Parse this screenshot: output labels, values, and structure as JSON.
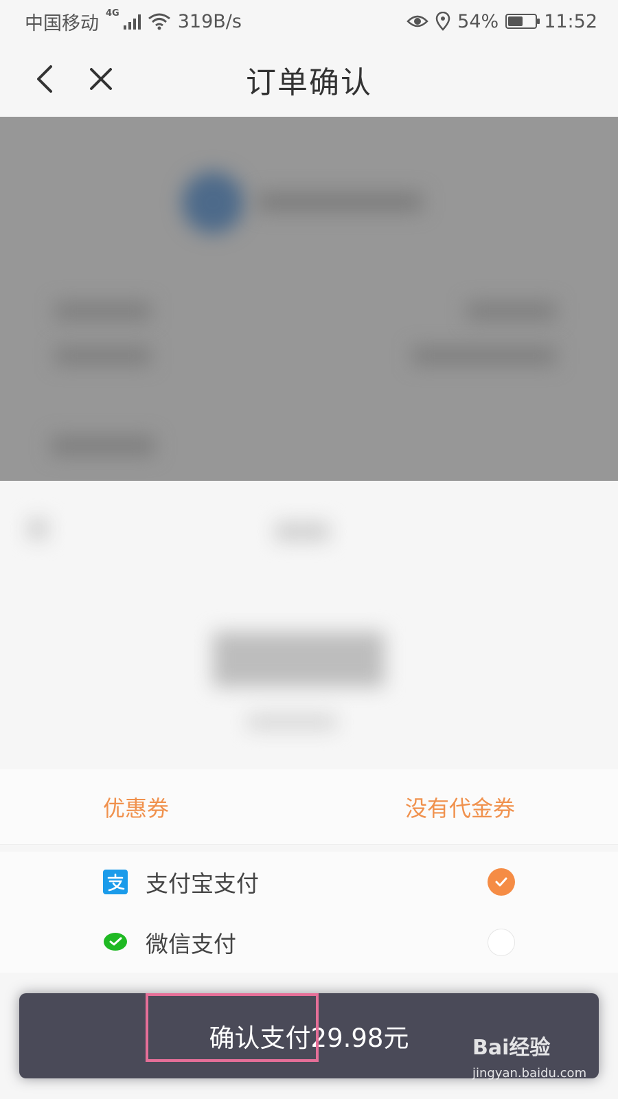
{
  "status_bar": {
    "carrier": "中国移动",
    "network_type": "4G",
    "speed": "319B/s",
    "battery": "54%",
    "battery_level": 0.54,
    "time": "11:52"
  },
  "header": {
    "title": "订单确认"
  },
  "coupon": {
    "label": "优惠券",
    "value": "没有代金券"
  },
  "payment_methods": [
    {
      "label": "支付宝支付",
      "selected": true
    },
    {
      "label": "微信支付",
      "selected": false
    }
  ],
  "confirm": {
    "label": "确认支付29.98元"
  },
  "watermark": {
    "logo": "Bai经验",
    "site": "jingyan.baidu.com"
  },
  "colors": {
    "accent_orange": "#f58c45",
    "coupon_text": "#f0914d",
    "confirm_bg": "#4a4a58",
    "highlight_border": "#e66f98",
    "alipay_blue": "#1a9bea",
    "wechat_green": "#1fb923"
  }
}
